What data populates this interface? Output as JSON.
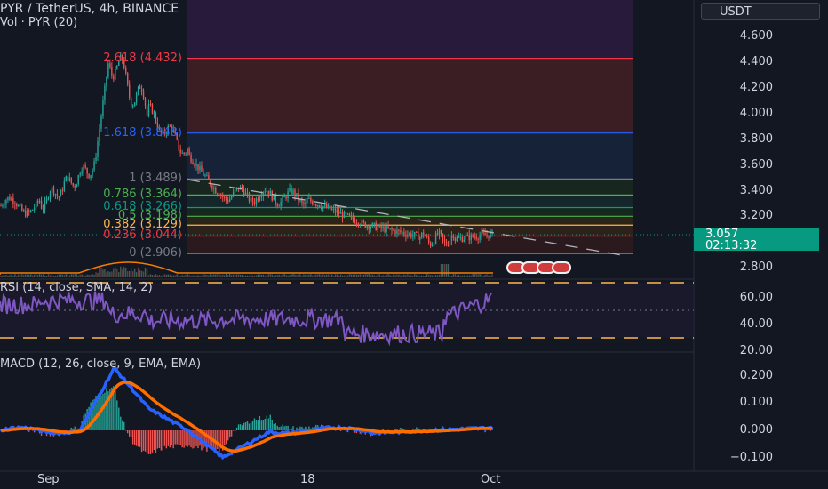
{
  "header": {
    "title": "PYR / TetherUS, 4h, BINANCE",
    "volume_label": "Vol · PYR (20)",
    "rsi_label": "RSI (14, close, SMA, 14, 2)",
    "macd_label": "MACD (12, 26, close, 9, EMA, EMA)"
  },
  "price_axis": {
    "currency_button": "USDT",
    "ticks": [
      "4.600",
      "4.400",
      "4.200",
      "4.000",
      "3.800",
      "3.600",
      "3.400",
      "3.200",
      "2.800"
    ],
    "last_price": "3.057",
    "countdown": "02:13:32"
  },
  "rsi_axis": {
    "ticks": [
      "60.00",
      "40.00",
      "20.00"
    ]
  },
  "macd_axis": {
    "ticks": [
      "0.200",
      "0.100",
      "0.000",
      "−0.100"
    ]
  },
  "time_axis": {
    "ticks": [
      "Sep",
      "18",
      "Oct"
    ]
  },
  "fib_levels": [
    {
      "label": "2.618 (4.432)",
      "price": 4.432,
      "color": "#f23645"
    },
    {
      "label": "1.618 (3.848)",
      "price": 3.848,
      "color": "#2962ff"
    },
    {
      "label": "1 (3.489)",
      "price": 3.489,
      "color": "#787b86"
    },
    {
      "label": "0.786 (3.364)",
      "price": 3.364,
      "color": "#4caf50"
    },
    {
      "label": "0.618 (3.266)",
      "price": 3.266,
      "color": "#089981"
    },
    {
      "label": "0.5 (3.198)",
      "price": 3.198,
      "color": "#4caf50"
    },
    {
      "label": "0.382 (3.129)",
      "price": 3.129,
      "color": "#ffb74d"
    },
    {
      "label": "0.236 (3.044)",
      "price": 3.044,
      "color": "#f23645"
    },
    {
      "label": "0 (2.906)",
      "price": 2.906,
      "color": "#787b86"
    }
  ],
  "colors": {
    "background": "#131722",
    "up": "#26a69a",
    "down": "#ef5350",
    "volume": "#f57c00",
    "rsi": "#7e57c2",
    "macd": "#2962ff",
    "signal": "#ff6d00",
    "rsi_band": "#ffb74d",
    "last_price": "#089981"
  },
  "events": {
    "icons": [
      "us-flag-icon",
      "us-flag-icon",
      "us-flag-icon"
    ]
  }
}
